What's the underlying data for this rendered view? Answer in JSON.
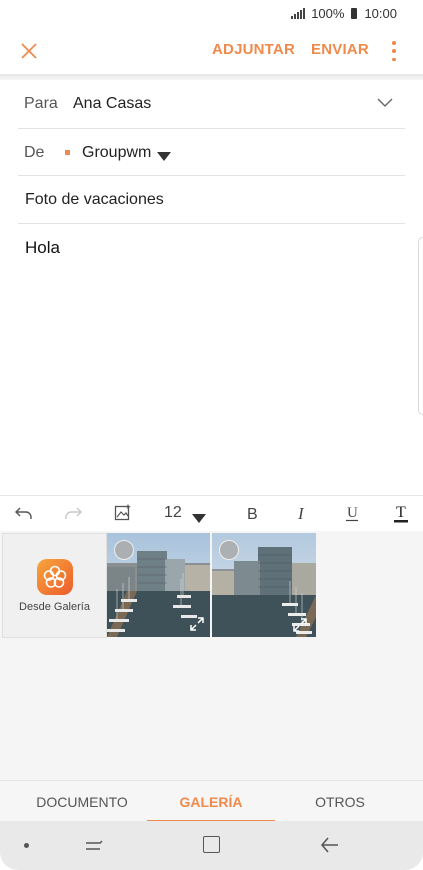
{
  "status_bar": {
    "battery": "100%",
    "time": "10:00"
  },
  "appbar": {
    "attach_label": "ADJUNTAR",
    "send_label": "ENVIAR"
  },
  "fields": {
    "to_label": "Para",
    "to_value": "Ana Casas",
    "from_label": "De",
    "from_value": "Groupwm",
    "subject": "Foto de vacaciones",
    "body": "Hola"
  },
  "toolbar": {
    "font_size": "12"
  },
  "gallery": {
    "from_gallery_label": "Desde Galería"
  },
  "tabs": [
    {
      "label": "DOCUMENTO"
    },
    {
      "label": "GALERÍA",
      "active": true
    },
    {
      "label": "OTROS"
    }
  ],
  "colors": {
    "accent": "#ef8a4c"
  }
}
